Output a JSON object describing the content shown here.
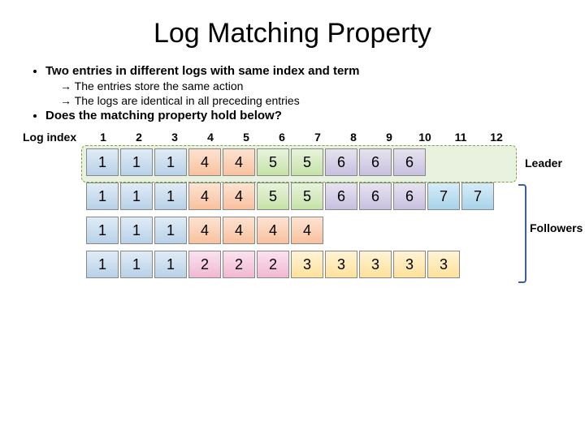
{
  "title": "Log Matching Property",
  "bullets": [
    {
      "text": "Two entries in different logs with same index and term",
      "subs": [
        "The entries store the same action",
        "The logs are identical in all preceding entries"
      ]
    },
    {
      "text": "Does the matching property hold below?",
      "subs": []
    }
  ],
  "index_label": "Log index",
  "indices": [
    "1",
    "2",
    "3",
    "4",
    "5",
    "6",
    "7",
    "8",
    "9",
    "10",
    "11",
    "12"
  ],
  "roles": {
    "leader": "Leader",
    "followers": "Followers"
  },
  "logs": [
    {
      "role": "leader",
      "entries": [
        1,
        1,
        1,
        4,
        4,
        5,
        5,
        6,
        6,
        6
      ]
    },
    {
      "role": "follower",
      "entries": [
        1,
        1,
        1,
        4,
        4,
        5,
        5,
        6,
        6,
        6,
        7,
        7
      ]
    },
    {
      "role": "follower",
      "entries": [
        1,
        1,
        1,
        4,
        4,
        4,
        4
      ]
    },
    {
      "role": "follower",
      "entries": [
        1,
        1,
        1,
        2,
        2,
        2,
        3,
        3,
        3,
        3,
        3
      ]
    }
  ],
  "term_colors": {
    "1": "t1",
    "2": "t2",
    "3": "t3",
    "4": "t4",
    "5": "t5",
    "6": "t6",
    "7": "t7"
  }
}
